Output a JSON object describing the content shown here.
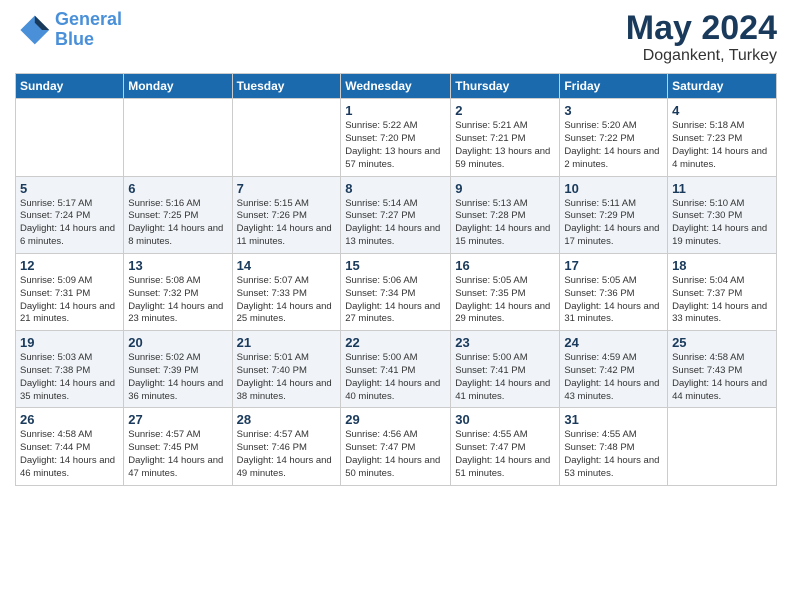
{
  "header": {
    "logo_line1": "General",
    "logo_line2": "Blue",
    "month": "May 2024",
    "location": "Dogankent, Turkey"
  },
  "weekdays": [
    "Sunday",
    "Monday",
    "Tuesday",
    "Wednesday",
    "Thursday",
    "Friday",
    "Saturday"
  ],
  "weeks": [
    [
      {
        "day": "",
        "info": ""
      },
      {
        "day": "",
        "info": ""
      },
      {
        "day": "",
        "info": ""
      },
      {
        "day": "1",
        "info": "Sunrise: 5:22 AM\nSunset: 7:20 PM\nDaylight: 13 hours and 57 minutes."
      },
      {
        "day": "2",
        "info": "Sunrise: 5:21 AM\nSunset: 7:21 PM\nDaylight: 13 hours and 59 minutes."
      },
      {
        "day": "3",
        "info": "Sunrise: 5:20 AM\nSunset: 7:22 PM\nDaylight: 14 hours and 2 minutes."
      },
      {
        "day": "4",
        "info": "Sunrise: 5:18 AM\nSunset: 7:23 PM\nDaylight: 14 hours and 4 minutes."
      }
    ],
    [
      {
        "day": "5",
        "info": "Sunrise: 5:17 AM\nSunset: 7:24 PM\nDaylight: 14 hours and 6 minutes."
      },
      {
        "day": "6",
        "info": "Sunrise: 5:16 AM\nSunset: 7:25 PM\nDaylight: 14 hours and 8 minutes."
      },
      {
        "day": "7",
        "info": "Sunrise: 5:15 AM\nSunset: 7:26 PM\nDaylight: 14 hours and 11 minutes."
      },
      {
        "day": "8",
        "info": "Sunrise: 5:14 AM\nSunset: 7:27 PM\nDaylight: 14 hours and 13 minutes."
      },
      {
        "day": "9",
        "info": "Sunrise: 5:13 AM\nSunset: 7:28 PM\nDaylight: 14 hours and 15 minutes."
      },
      {
        "day": "10",
        "info": "Sunrise: 5:11 AM\nSunset: 7:29 PM\nDaylight: 14 hours and 17 minutes."
      },
      {
        "day": "11",
        "info": "Sunrise: 5:10 AM\nSunset: 7:30 PM\nDaylight: 14 hours and 19 minutes."
      }
    ],
    [
      {
        "day": "12",
        "info": "Sunrise: 5:09 AM\nSunset: 7:31 PM\nDaylight: 14 hours and 21 minutes."
      },
      {
        "day": "13",
        "info": "Sunrise: 5:08 AM\nSunset: 7:32 PM\nDaylight: 14 hours and 23 minutes."
      },
      {
        "day": "14",
        "info": "Sunrise: 5:07 AM\nSunset: 7:33 PM\nDaylight: 14 hours and 25 minutes."
      },
      {
        "day": "15",
        "info": "Sunrise: 5:06 AM\nSunset: 7:34 PM\nDaylight: 14 hours and 27 minutes."
      },
      {
        "day": "16",
        "info": "Sunrise: 5:05 AM\nSunset: 7:35 PM\nDaylight: 14 hours and 29 minutes."
      },
      {
        "day": "17",
        "info": "Sunrise: 5:05 AM\nSunset: 7:36 PM\nDaylight: 14 hours and 31 minutes."
      },
      {
        "day": "18",
        "info": "Sunrise: 5:04 AM\nSunset: 7:37 PM\nDaylight: 14 hours and 33 minutes."
      }
    ],
    [
      {
        "day": "19",
        "info": "Sunrise: 5:03 AM\nSunset: 7:38 PM\nDaylight: 14 hours and 35 minutes."
      },
      {
        "day": "20",
        "info": "Sunrise: 5:02 AM\nSunset: 7:39 PM\nDaylight: 14 hours and 36 minutes."
      },
      {
        "day": "21",
        "info": "Sunrise: 5:01 AM\nSunset: 7:40 PM\nDaylight: 14 hours and 38 minutes."
      },
      {
        "day": "22",
        "info": "Sunrise: 5:00 AM\nSunset: 7:41 PM\nDaylight: 14 hours and 40 minutes."
      },
      {
        "day": "23",
        "info": "Sunrise: 5:00 AM\nSunset: 7:41 PM\nDaylight: 14 hours and 41 minutes."
      },
      {
        "day": "24",
        "info": "Sunrise: 4:59 AM\nSunset: 7:42 PM\nDaylight: 14 hours and 43 minutes."
      },
      {
        "day": "25",
        "info": "Sunrise: 4:58 AM\nSunset: 7:43 PM\nDaylight: 14 hours and 44 minutes."
      }
    ],
    [
      {
        "day": "26",
        "info": "Sunrise: 4:58 AM\nSunset: 7:44 PM\nDaylight: 14 hours and 46 minutes."
      },
      {
        "day": "27",
        "info": "Sunrise: 4:57 AM\nSunset: 7:45 PM\nDaylight: 14 hours and 47 minutes."
      },
      {
        "day": "28",
        "info": "Sunrise: 4:57 AM\nSunset: 7:46 PM\nDaylight: 14 hours and 49 minutes."
      },
      {
        "day": "29",
        "info": "Sunrise: 4:56 AM\nSunset: 7:47 PM\nDaylight: 14 hours and 50 minutes."
      },
      {
        "day": "30",
        "info": "Sunrise: 4:55 AM\nSunset: 7:47 PM\nDaylight: 14 hours and 51 minutes."
      },
      {
        "day": "31",
        "info": "Sunrise: 4:55 AM\nSunset: 7:48 PM\nDaylight: 14 hours and 53 minutes."
      },
      {
        "day": "",
        "info": ""
      }
    ]
  ]
}
